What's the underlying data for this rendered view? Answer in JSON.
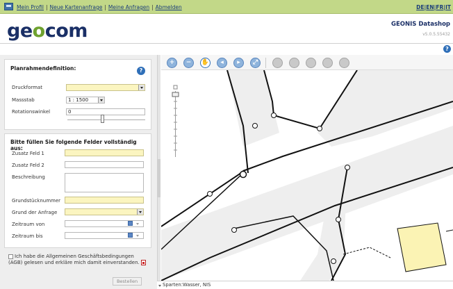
{
  "topbar": {
    "links": [
      "Mein Profil",
      "Neue Kartenanfrage",
      "Meine Anfragen",
      "Abmelden"
    ],
    "languages": [
      "DE",
      "EN",
      "FR",
      "IT"
    ]
  },
  "header": {
    "logo": "geocom",
    "app_title": "GEONIS Datashop",
    "version": "v5.0.5.55432"
  },
  "plan": {
    "title": "Planrahmendefinition:",
    "druckformat_label": "Druckformat",
    "druckformat_value": "",
    "massstab_label": "Massstab",
    "massstab_value": "1 : 1500",
    "rotation_label": "Rotationswinkel",
    "rotation_value": "0",
    "rotation_level": 0.45
  },
  "form": {
    "title": "Bitte füllen Sie folgende Felder vollständig aus:",
    "zusatz1_label": "Zusatz Feld 1",
    "zusatz2_label": "Zusatz Feld 2",
    "beschreibung_label": "Beschreibung",
    "grundstueck_label": "Grundstücknummer",
    "grund_label": "Grund der Anfrage",
    "zeitraum_von_label": "Zeitraum von",
    "zeitraum_bis_label": "Zeitraum bis"
  },
  "agb": {
    "text": "Ich habe die Allgemeinen Geschäftsbedingungen (AGB) gelesen und erkläre mich damit einverstanden."
  },
  "submit_label": "Bestellen",
  "toolbar": {
    "tools": [
      "zoom-in",
      "zoom-out",
      "pan",
      "back",
      "forward",
      "full-extent",
      "print",
      "layers",
      "measure",
      "info",
      "settings"
    ]
  },
  "status": {
    "text": "Sparten:Wasser, NIS"
  },
  "colors": {
    "nav_bg": "#c2d888",
    "brand_dark": "#1a2f66",
    "brand_green": "#6fa22f",
    "required_field": "#fbf5c0",
    "road": "#eeeeee",
    "parcel": "#fbf3b4"
  }
}
